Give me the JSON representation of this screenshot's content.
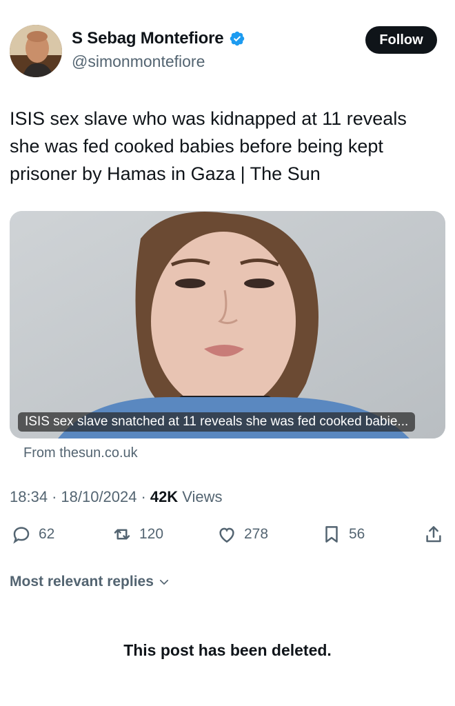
{
  "author": {
    "display_name": "S Sebag Montefiore",
    "handle": "@simonmontefiore",
    "verified_icon": "verified-badge-icon",
    "follow_label": "Follow"
  },
  "tweet": {
    "text": "ISIS sex slave who was kidnapped at 11 reveals she was fed cooked babies before being kept prisoner by Hamas in Gaza | The Sun"
  },
  "link_card": {
    "caption": "ISIS sex slave snatched at 11 reveals she was fed cooked babie...",
    "source": "From thesun.co.uk"
  },
  "meta": {
    "time": "18:34",
    "date": "18/10/2024",
    "views_count": "42K",
    "views_label": "Views",
    "separator": "·"
  },
  "actions": {
    "replies": "62",
    "reposts": "120",
    "likes": "278",
    "bookmarks": "56"
  },
  "replies_filter": {
    "label": "Most relevant replies"
  },
  "notice": {
    "text": "This post has been deleted."
  },
  "colors": {
    "text_primary": "#0f1419",
    "text_secondary": "#536471",
    "verified_blue": "#1d9bf0",
    "follow_bg": "#0f1419"
  }
}
